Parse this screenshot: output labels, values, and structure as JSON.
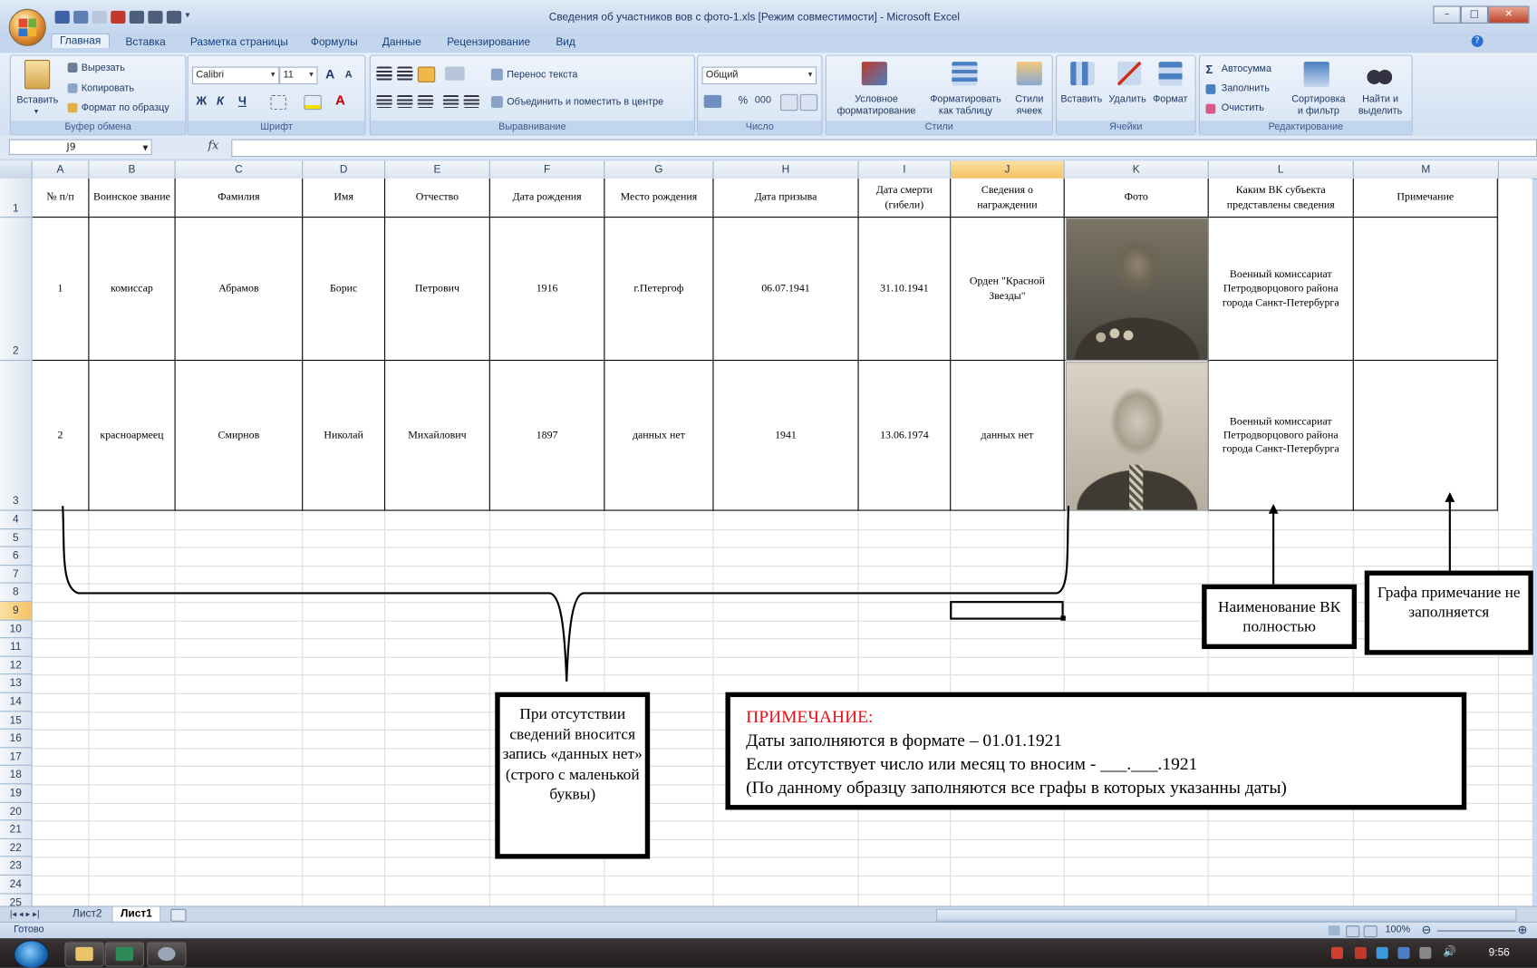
{
  "window": {
    "title": "Сведения об участников вов с фото-1.xls  [Режим совместимости] - Microsoft Excel",
    "controls": {
      "minimize": "–",
      "maximize": "□",
      "close": "✕"
    }
  },
  "ribbon_tabs": [
    "Главная",
    "Вставка",
    "Разметка страницы",
    "Формулы",
    "Данные",
    "Рецензирование",
    "Вид"
  ],
  "ribbon": {
    "clipboard": {
      "paste": "Вставить",
      "cut": "Вырезать",
      "copy": "Копировать",
      "format_painter": "Формат по образцу",
      "label": "Буфер обмена"
    },
    "font": {
      "name": "Calibri",
      "size": "11",
      "bold": "Ж",
      "italic": "К",
      "underline": "Ч",
      "grow": "A",
      "shrink": "A",
      "label": "Шрифт"
    },
    "alignment": {
      "wrap": "Перенос текста",
      "merge": "Объединить и поместить в центре",
      "label": "Выравнивание"
    },
    "number": {
      "format": "Общий",
      "percent": "%",
      "thousands": "000",
      "inc_decimals": ",0\n,00",
      "dec_decimals": ",00\n,0",
      "label": "Число"
    },
    "styles": {
      "conditional": "Условное форматирование",
      "as_table": "Форматировать как таблицу",
      "cell_styles": "Стили ячеек",
      "label": "Стили"
    },
    "cells": {
      "insert": "Вставить",
      "delete": "Удалить",
      "format": "Формат",
      "label": "Ячейки"
    },
    "editing": {
      "autosum": "Автосумма",
      "fill": "Заполнить",
      "clear": "Очистить",
      "sort": "Сортировка и фильтр",
      "find": "Найти и выделить",
      "label": "Редактирование"
    }
  },
  "formula_bar": {
    "name_box": "J9",
    "fx": "fx",
    "content": ""
  },
  "columns": [
    "A",
    "B",
    "C",
    "D",
    "E",
    "F",
    "G",
    "H",
    "I",
    "J",
    "K",
    "L",
    "M"
  ],
  "rows": [
    "1",
    "2",
    "3",
    "4",
    "5",
    "6",
    "7",
    "8",
    "9",
    "10",
    "11",
    "12",
    "13",
    "14",
    "15",
    "16",
    "17",
    "18",
    "19",
    "20",
    "21",
    "22",
    "23",
    "24",
    "25"
  ],
  "table": {
    "headers": [
      "№ п/п",
      "Воинское звание",
      "Фамилия",
      "Имя",
      "Отчество",
      "Дата рождения",
      "Место рождения",
      "Дата призыва",
      "Дата смерти (гибели)",
      "Сведения о награждении",
      "Фото",
      "Каким ВК субъекта представлены сведения",
      "Примечание"
    ],
    "rows": [
      [
        "1",
        "комиссар",
        "Абрамов",
        "Борис",
        "Петрович",
        "1916",
        "г.Петергоф",
        "06.07.1941",
        "31.10.1941",
        "Орден \"Красной Звезды\"",
        "",
        "Военный комиссариат Петродворцового района города Санкт-Петербурга",
        ""
      ],
      [
        "2",
        "красноармеец",
        "Смирнов",
        "Николай",
        "Михайлович",
        "1897",
        "данных нет",
        "1941",
        "13.06.1974",
        "данных нет",
        "",
        "Военный комиссариат Петродворцового района города Санкт-Петербурга",
        ""
      ]
    ]
  },
  "annotations": {
    "vk_name": "Наименование ВК полностью",
    "note_column": "Графа примечание не заполняется",
    "no_data": "При отсутствии сведений вносится запись «данных нет» (строго с маленькой буквы)",
    "remark_title": "ПРИМЕЧАНИЕ:",
    "remark_lines": [
      "Даты заполняются в формате – 01.01.1921",
      "Если отсутствует число или месяц то вносим - ___.___.1921",
      "(По данному образцу заполняются все графы в которых указанны даты)"
    ]
  },
  "sheet_tabs": [
    "Лист2",
    "Лист1"
  ],
  "status": {
    "ready": "Готово",
    "zoom": "100%"
  },
  "taskbar": {
    "time": "9:56"
  },
  "colors": {
    "remark_title": "#e8121b",
    "selection": "#f4c262"
  }
}
